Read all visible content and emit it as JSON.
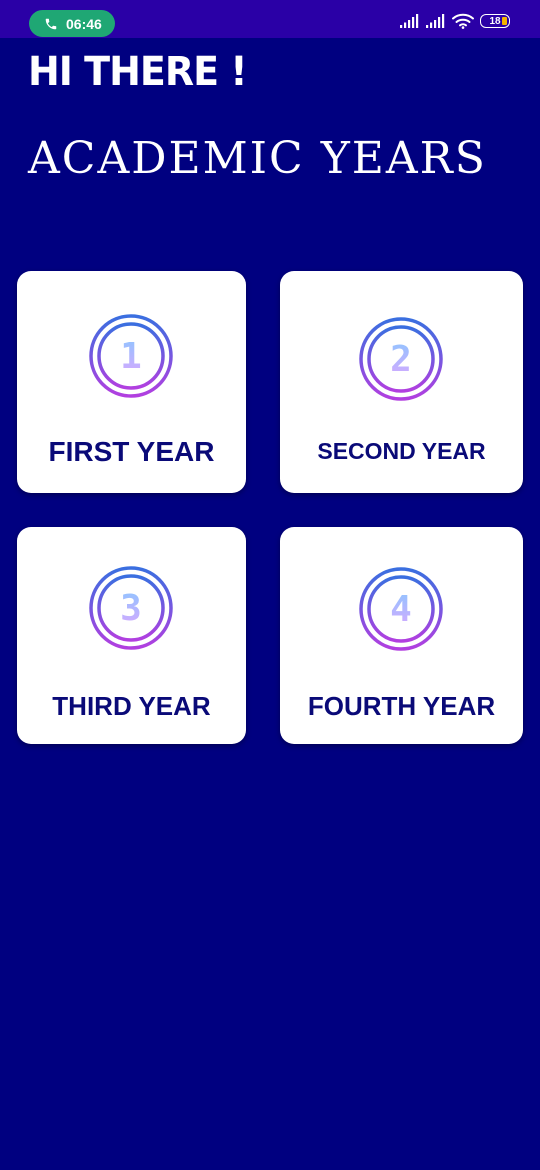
{
  "status_bar": {
    "time": "06:46",
    "battery_level": "18",
    "icons": [
      "phone-icon",
      "signal-icon",
      "signal-icon",
      "wifi-icon",
      "battery-icon"
    ]
  },
  "header": {
    "greeting": "HI THERE !",
    "title": "ACADEMIC YEARS"
  },
  "cards": [
    {
      "label": "FIRST YEAR",
      "number": "1",
      "icon": "number-one-icon"
    },
    {
      "label": "SECOND YEAR",
      "number": "2",
      "icon": "number-two-icon"
    },
    {
      "label": "THIRD YEAR",
      "number": "3",
      "icon": "number-three-icon"
    },
    {
      "label": "FOURTH YEAR",
      "number": "4",
      "icon": "number-four-icon"
    }
  ],
  "colors": {
    "background": "#000080",
    "status_bar": "#2A00A6",
    "call_pill": "#1FA774",
    "card": "#ffffff",
    "card_text": "#0A0A78",
    "badge_gradient_top": "#3A6FE0",
    "badge_gradient_bottom": "#B23FE0",
    "digit_gradient_top": "#8EC5FF",
    "digit_gradient_bottom": "#D8A8FF"
  }
}
